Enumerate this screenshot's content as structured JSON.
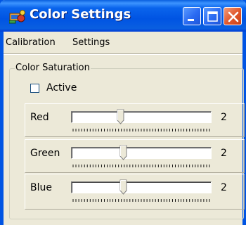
{
  "window": {
    "title": "Color Settings",
    "title_color": "#ffffff",
    "titlebar_color": "#0054e3",
    "face_color": "#ece9d8"
  },
  "menu": [
    {
      "label": "Calibration"
    },
    {
      "label": "Settings"
    }
  ],
  "color_saturation": {
    "legend": "Color Saturation",
    "active": {
      "label": "Active",
      "checked": false
    },
    "sliders": [
      {
        "label": "Red",
        "value": "2",
        "level": 0.35
      },
      {
        "label": "Green",
        "value": "2",
        "level": 0.37
      },
      {
        "label": "Blue",
        "value": "2",
        "level": 0.37
      }
    ]
  },
  "icons": {
    "app": "color-settings-app-icon",
    "minimize": "minimize-icon",
    "maximize": "maximize-icon",
    "close": "close-icon"
  }
}
